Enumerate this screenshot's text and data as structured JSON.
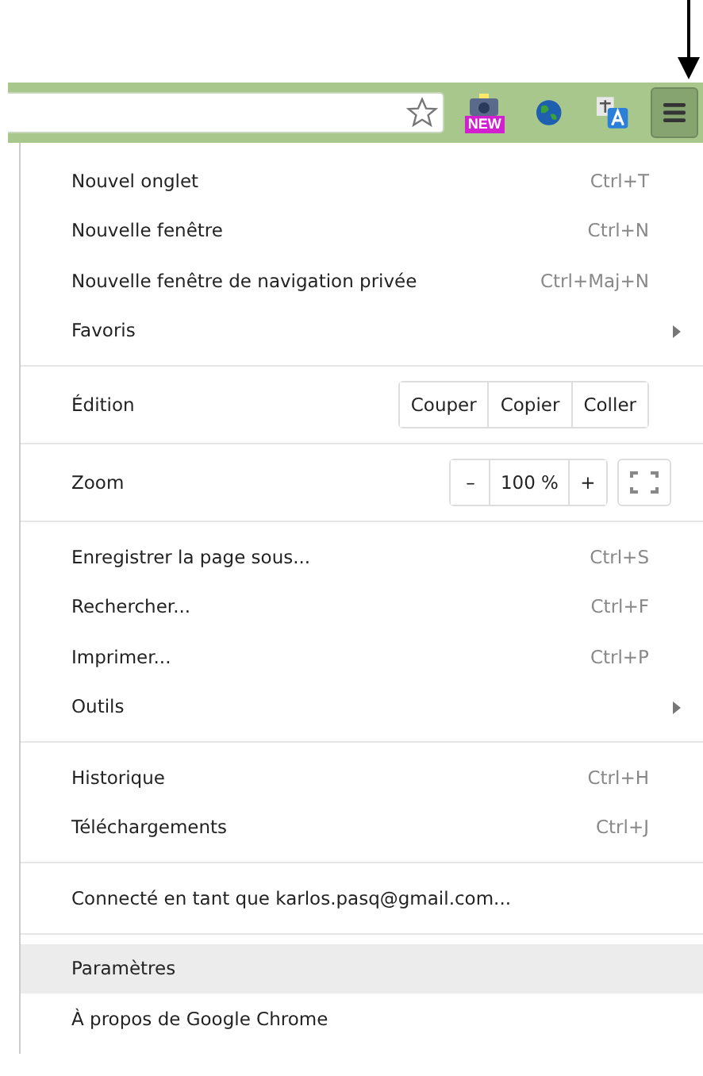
{
  "toolbar": {
    "extension_badge": "NEW"
  },
  "menu": {
    "sections": [
      {
        "items": [
          {
            "kind": "item",
            "label": "Nouvel onglet",
            "shortcut": "Ctrl+T",
            "submenu": false,
            "selected": false
          },
          {
            "kind": "item",
            "label": "Nouvelle fenêtre",
            "shortcut": "Ctrl+N",
            "submenu": false,
            "selected": false
          },
          {
            "kind": "item",
            "label": "Nouvelle fenêtre de navigation privée",
            "shortcut": "Ctrl+Maj+N",
            "submenu": false,
            "selected": false
          },
          {
            "kind": "item",
            "label": "Favoris",
            "submenu": true,
            "selected": false
          }
        ]
      },
      {
        "items": [
          {
            "kind": "edit",
            "label": "Édition",
            "buttons": [
              "Couper",
              "Copier",
              "Coller"
            ]
          }
        ]
      },
      {
        "items": [
          {
            "kind": "zoom",
            "label": "Zoom",
            "minus": "–",
            "value": "100 %",
            "plus": "+"
          }
        ]
      },
      {
        "items": [
          {
            "kind": "item",
            "label": "Enregistrer la page sous...",
            "shortcut": "Ctrl+S",
            "submenu": false,
            "selected": false
          },
          {
            "kind": "item",
            "label": "Rechercher...",
            "shortcut": "Ctrl+F",
            "submenu": false,
            "selected": false
          },
          {
            "kind": "item",
            "label": "Imprimer...",
            "shortcut": "Ctrl+P",
            "submenu": false,
            "selected": false
          },
          {
            "kind": "item",
            "label": "Outils",
            "submenu": true,
            "selected": false
          }
        ]
      },
      {
        "items": [
          {
            "kind": "item",
            "label": "Historique",
            "shortcut": "Ctrl+H",
            "submenu": false,
            "selected": false
          },
          {
            "kind": "item",
            "label": "Téléchargements",
            "shortcut": "Ctrl+J",
            "submenu": false,
            "selected": false
          }
        ]
      },
      {
        "items": [
          {
            "kind": "item",
            "label": "Connecté en tant que karlos.pasq@gmail.com...",
            "submenu": false,
            "selected": false
          }
        ]
      },
      {
        "items": [
          {
            "kind": "item",
            "label": "Paramètres",
            "submenu": false,
            "selected": true
          },
          {
            "kind": "item",
            "label": "À propos de Google Chrome",
            "submenu": false,
            "selected": false
          }
        ]
      }
    ]
  }
}
